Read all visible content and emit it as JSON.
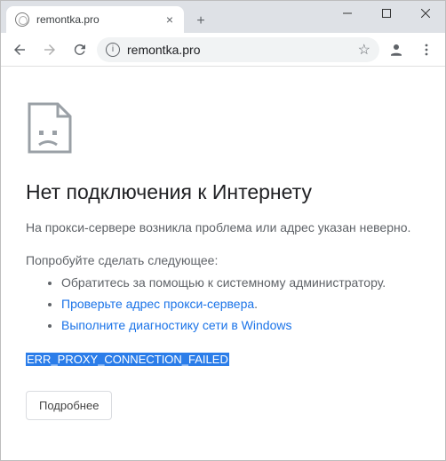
{
  "window": {
    "tab_title": "remontka.pro",
    "url": "remontka.pro"
  },
  "error": {
    "heading": "Нет подключения к Интернету",
    "subtext": "На прокси-сервере возникла проблема или адрес указан неверно.",
    "try_heading": "Попробуйте сделать следующее:",
    "suggestions": {
      "s1": "Обратитесь за помощью к системному администратору.",
      "s2_link": "Проверьте адрес прокси-сервера",
      "s2_tail": ".",
      "s3_link": "Выполните диагностику сети в Windows"
    },
    "code": "ERR_PROXY_CONNECTION_FAILED",
    "details_button": "Подробнее"
  }
}
